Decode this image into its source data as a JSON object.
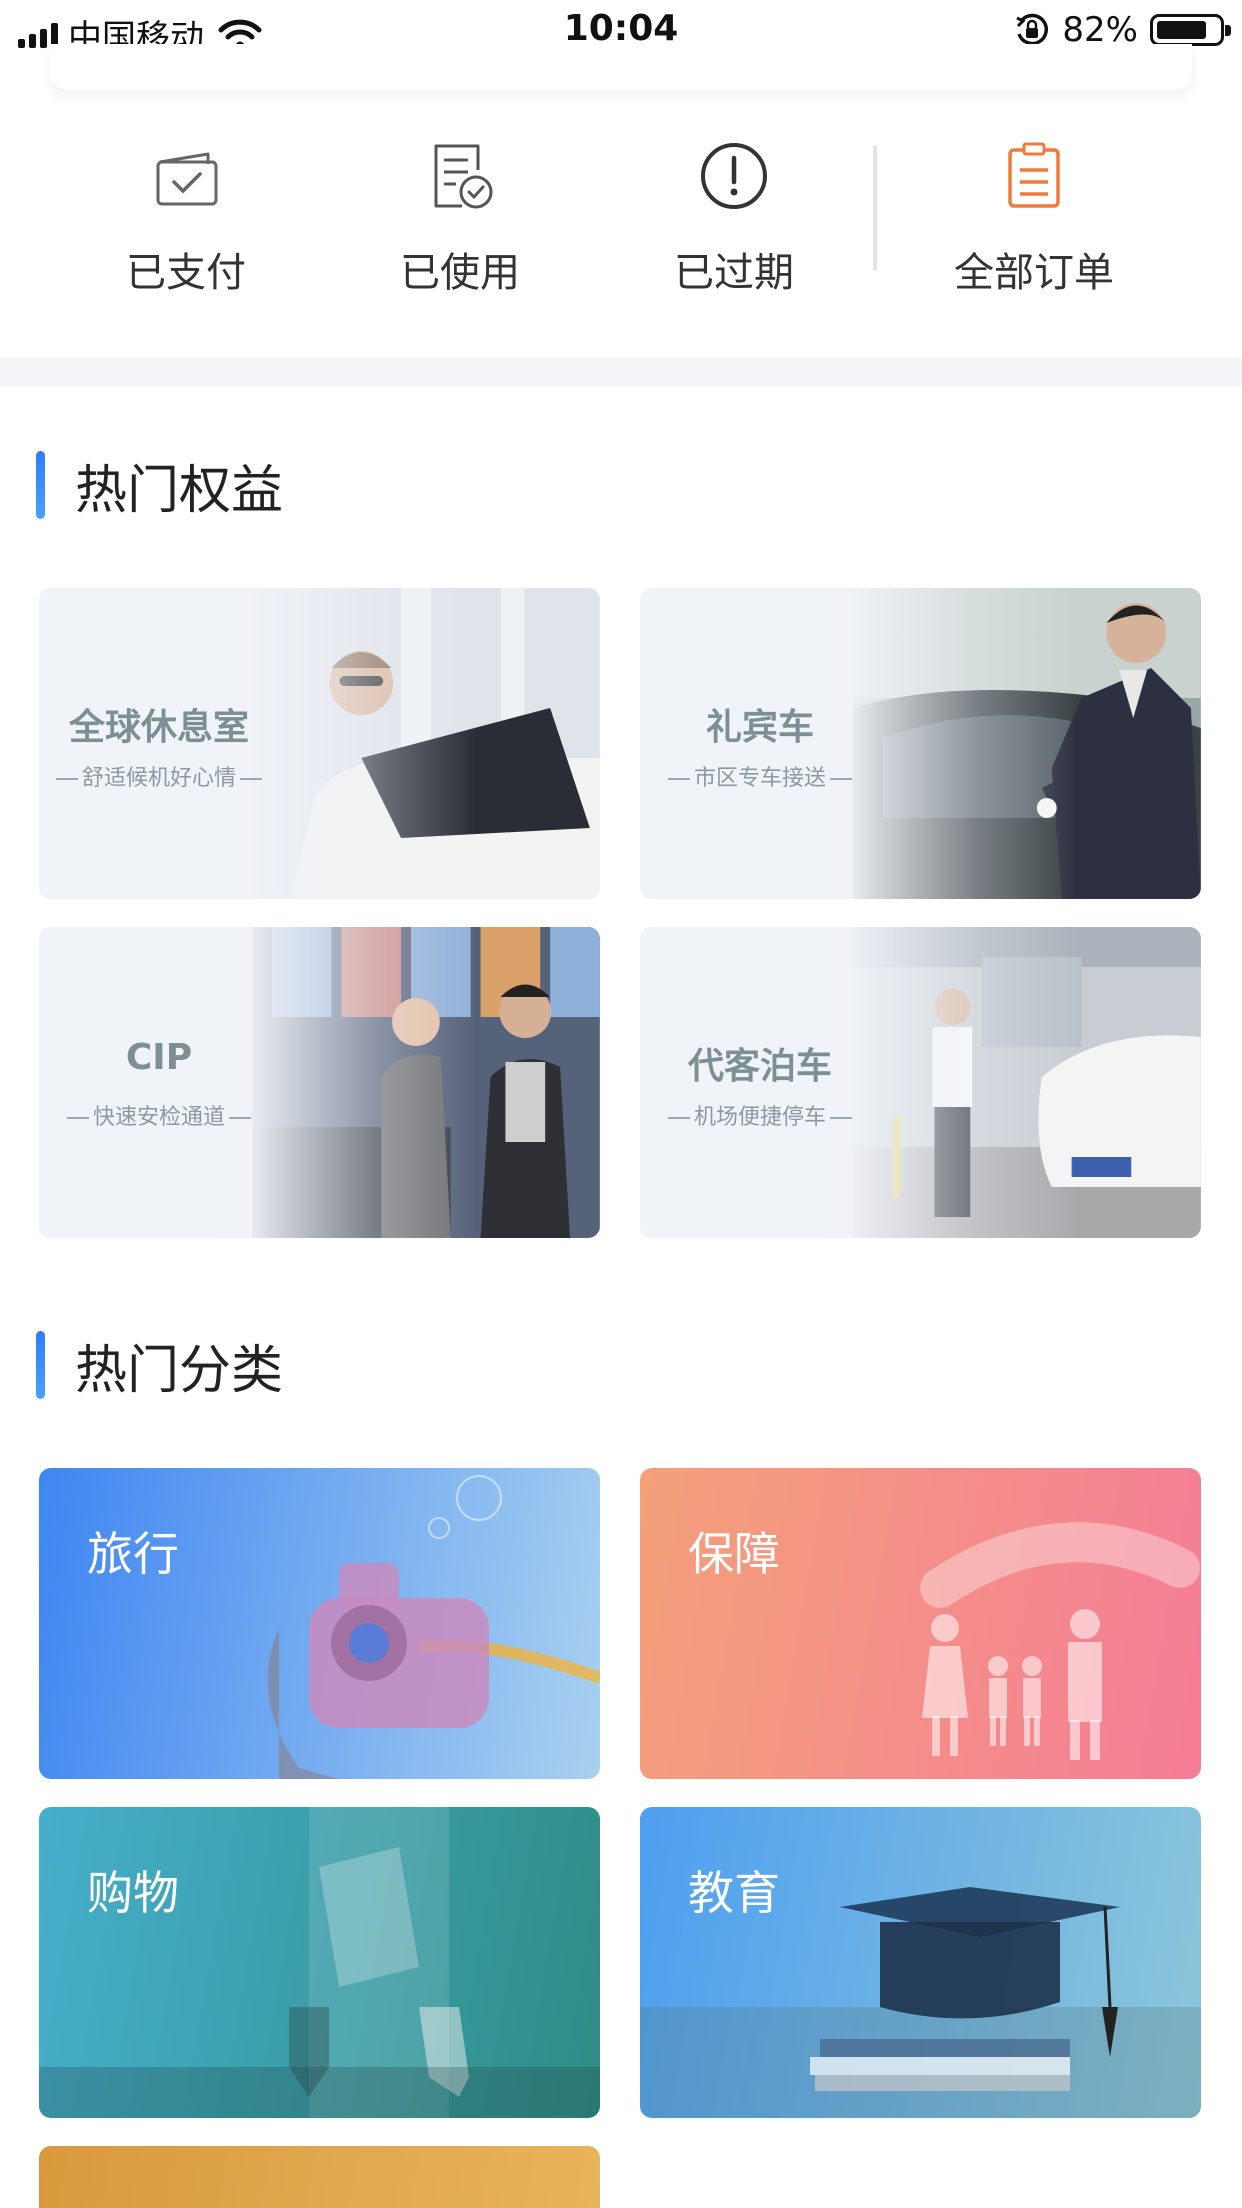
{
  "status_bar": {
    "carrier": "中国移动",
    "time": "10:04",
    "battery": "82%",
    "battery_level": 0.82
  },
  "orders": [
    {
      "label": "已支付",
      "icon": "wallet-check-icon"
    },
    {
      "label": "已使用",
      "icon": "document-check-icon"
    },
    {
      "label": "已过期",
      "icon": "exclamation-circle-icon"
    },
    {
      "label": "全部订单",
      "icon": "clipboard-list-icon",
      "color": "#f07a3c"
    }
  ],
  "hot_benefits": {
    "title": "热门权益",
    "items": [
      {
        "title": "全球休息室",
        "subtitle": "舒适候机好心情"
      },
      {
        "title": "礼宾车",
        "subtitle": "市区专车接送"
      },
      {
        "title": "CIP",
        "subtitle": "快速安检通道"
      },
      {
        "title": "代客泊车",
        "subtitle": "机场便捷停车"
      }
    ]
  },
  "hot_categories": {
    "title": "热门分类",
    "items": [
      {
        "label": "旅行",
        "colors": [
          "#3f86f2",
          "#a9d0ef"
        ]
      },
      {
        "label": "保障",
        "colors": [
          "#f4a07a",
          "#f57d97"
        ]
      },
      {
        "label": "购物",
        "colors": [
          "#46aecb",
          "#2f8d86"
        ]
      },
      {
        "label": "教育",
        "colors": [
          "#4f9ff0",
          "#8cc6d9"
        ]
      },
      {
        "label": "",
        "colors": [
          "#d99a3c",
          "#e8b45c"
        ]
      }
    ]
  },
  "colors": {
    "accent_blue": "#2f7bff",
    "orange": "#f07a3c",
    "section_gap": "#f3f5f8"
  }
}
